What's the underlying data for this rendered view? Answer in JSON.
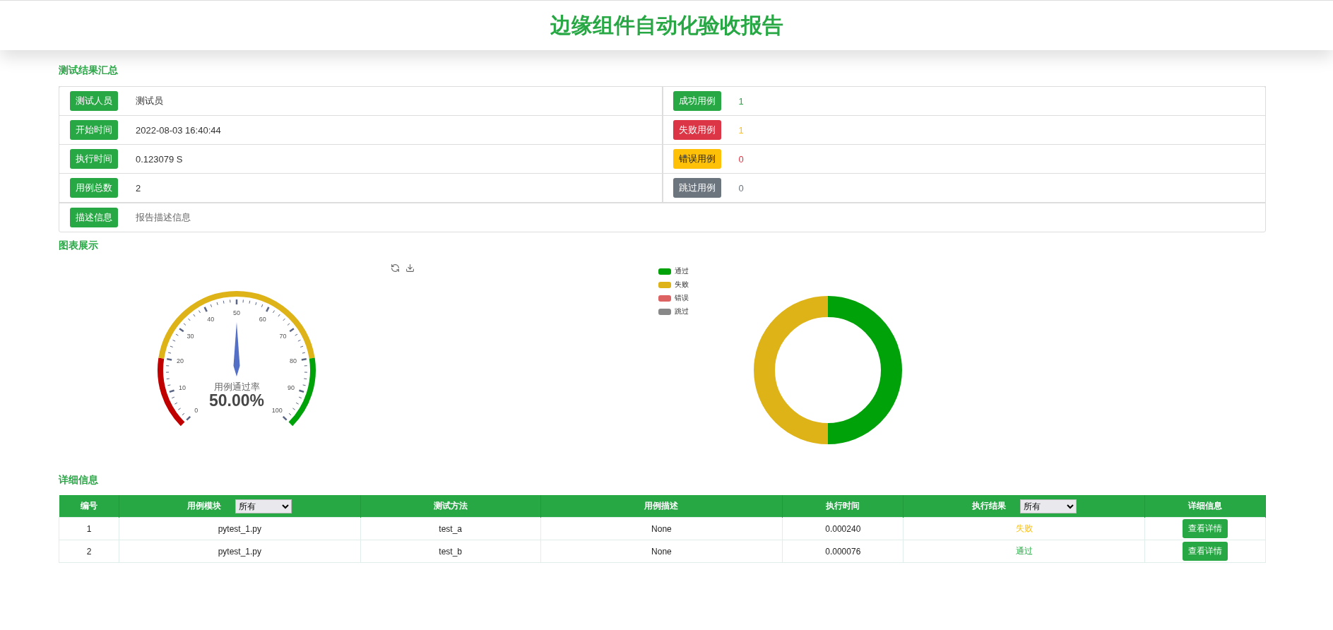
{
  "header": {
    "title": "边缘组件自动化验收报告"
  },
  "summary": {
    "title": "测试结果汇总",
    "left": [
      {
        "label": "测试人员",
        "value": "测试员"
      },
      {
        "label": "开始时间",
        "value": "2022-08-03 16:40:44"
      },
      {
        "label": "执行时间",
        "value": "0.123079 S"
      },
      {
        "label": "用例总数",
        "value": "2"
      }
    ],
    "right": [
      {
        "label": "成功用例",
        "value": "1",
        "kind": "success"
      },
      {
        "label": "失败用例",
        "value": "1",
        "kind": "failure"
      },
      {
        "label": "错误用例",
        "value": "0",
        "kind": "error"
      },
      {
        "label": "跳过用例",
        "value": "0",
        "kind": "skip"
      }
    ],
    "description": {
      "label": "描述信息",
      "value": "报告描述信息"
    }
  },
  "charts": {
    "title": "图表展示",
    "gauge": {
      "title": "用例通过率",
      "value": "50.00%",
      "ticks": [
        "0",
        "10",
        "20",
        "30",
        "40",
        "50",
        "60",
        "70",
        "80",
        "90",
        "100"
      ]
    },
    "legend": [
      {
        "label": "通过",
        "color": "#00a20a"
      },
      {
        "label": "失败",
        "color": "#deb318"
      },
      {
        "label": "错误",
        "color": "#dd6262"
      },
      {
        "label": "跳过",
        "color": "#888888"
      }
    ]
  },
  "details": {
    "title": "详细信息",
    "columns": [
      {
        "label": "编号"
      },
      {
        "label": "用例模块",
        "filter": "所有"
      },
      {
        "label": "测试方法"
      },
      {
        "label": "用例描述"
      },
      {
        "label": "执行时间"
      },
      {
        "label": "执行结果",
        "filter": "所有"
      },
      {
        "label": "详细信息"
      }
    ],
    "rows": [
      {
        "cells": [
          "1",
          "pytest_1.py",
          "test_a",
          "None",
          "0.000240"
        ],
        "result": {
          "label": "失败",
          "kind": "fail"
        },
        "action": "查看详情"
      },
      {
        "cells": [
          "2",
          "pytest_1.py",
          "test_b",
          "None",
          "0.000076"
        ],
        "result": {
          "label": "通过",
          "kind": "pass"
        },
        "action": "查看详情"
      }
    ]
  }
}
